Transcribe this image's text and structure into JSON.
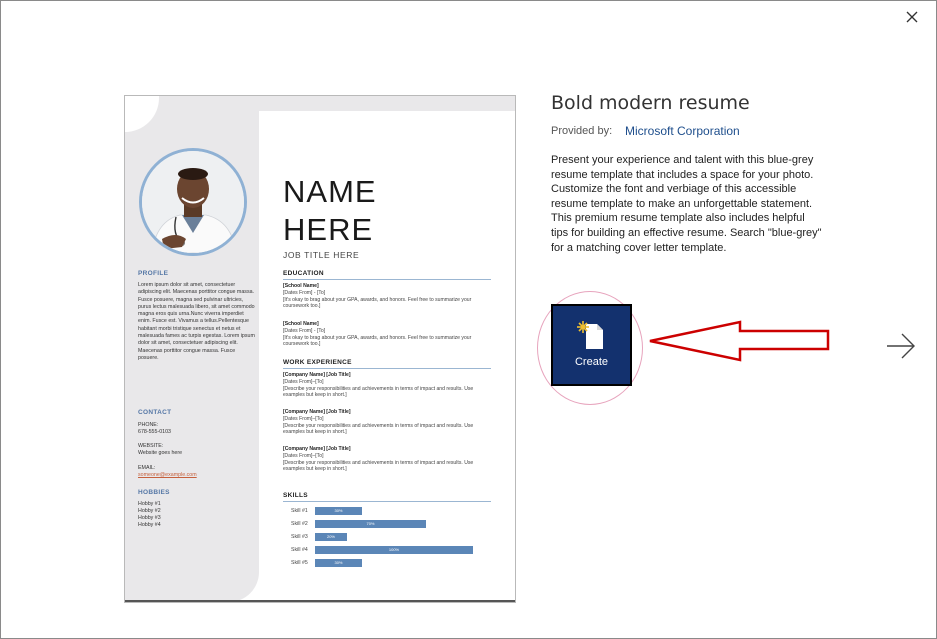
{
  "dialog": {
    "close_icon": "close-icon",
    "next_icon": "arrow-right-icon"
  },
  "template": {
    "title": "Bold modern resume",
    "provided_by_label": "Provided by:",
    "provider": "Microsoft Corporation",
    "description": "Present your experience and talent with this blue-grey resume template that includes a space for your photo. Customize the font and verbiage of this accessible resume template to make an unforgettable statement. This premium resume template also includes helpful tips for building an effective resume. Search \"blue-grey\" for a matching cover letter template.",
    "create_label": "Create"
  },
  "preview": {
    "name_line1": "NAME",
    "name_line2": "HERE",
    "job_title": "JOB TITLE HERE",
    "profile_head": "PROFILE",
    "profile_text": "Lorem ipsum dolor sit amet, consectetuer adipiscing elit. Maecenas porttitor congue massa. Fusce posuere, magna sed pulvinar ultricies, purus lectus malesuada libero, sit amet commodo magna eros quis urna.Nunc viverra imperdiet enim. Fusce est. Vivamus a tellus.Pellentesque habitant morbi tristique senectus et netus et malesuada fames ac turpis egestas. Lorem ipsum dolor sit amet, consectetuer adipiscing elit. Maecenas porttitor congue massa. Fusce posuere.",
    "contact_head": "CONTACT",
    "phone_label": "PHONE:",
    "phone": "678-555-0103",
    "website_label": "WEBSITE:",
    "website": "Website goes here",
    "email_label": "EMAIL:",
    "email": "someone@example.com",
    "hobbies_head": "HOBBIES",
    "hobbies": [
      "Hobby #1",
      "Hobby #2",
      "Hobby #3",
      "Hobby #4"
    ],
    "education_head": "EDUCATION",
    "education": [
      {
        "title": "[School Name]",
        "dates": "[Dates From] - [To]",
        "desc": "[It's okay to brag about your GPA, awards, and honors. Feel free to summarize your coursework too.]"
      },
      {
        "title": "[School Name]",
        "dates": "[Dates From] - [To]",
        "desc": "[It's okay to brag about your GPA, awards, and honors. Feel free to summarize your coursework too.]"
      }
    ],
    "work_head": "WORK EXPERIENCE",
    "work": [
      {
        "title": "[Company Name]  [Job Title]",
        "dates": "[Dates From]–[To]",
        "desc": "[Describe your responsibilities and achievements in terms of impact and results. Use examples but keep in short.]"
      },
      {
        "title": "[Company Name]  [Job Title]",
        "dates": "[Dates From]–[To]",
        "desc": "[Describe your responsibilities and achievements in terms of impact and results. Use examples but keep in short.]"
      },
      {
        "title": "[Company Name]  [Job Title]",
        "dates": "[Dates From]–[To]",
        "desc": "[Describe your responsibilities and achievements in terms of impact and results. Use examples but keep in short.]"
      }
    ],
    "skills_head": "SKILLS",
    "skills": [
      {
        "label": "Skill #1",
        "value": 30
      },
      {
        "label": "Skill #2",
        "value": 70
      },
      {
        "label": "Skill #3",
        "value": 20
      },
      {
        "label": "Skill #4",
        "value": 100
      },
      {
        "label": "Skill #5",
        "value": 30
      }
    ]
  },
  "colors": {
    "accent": "#13316e",
    "annotation": "#cc0000",
    "highlight_ring": "#e7a4bd"
  }
}
